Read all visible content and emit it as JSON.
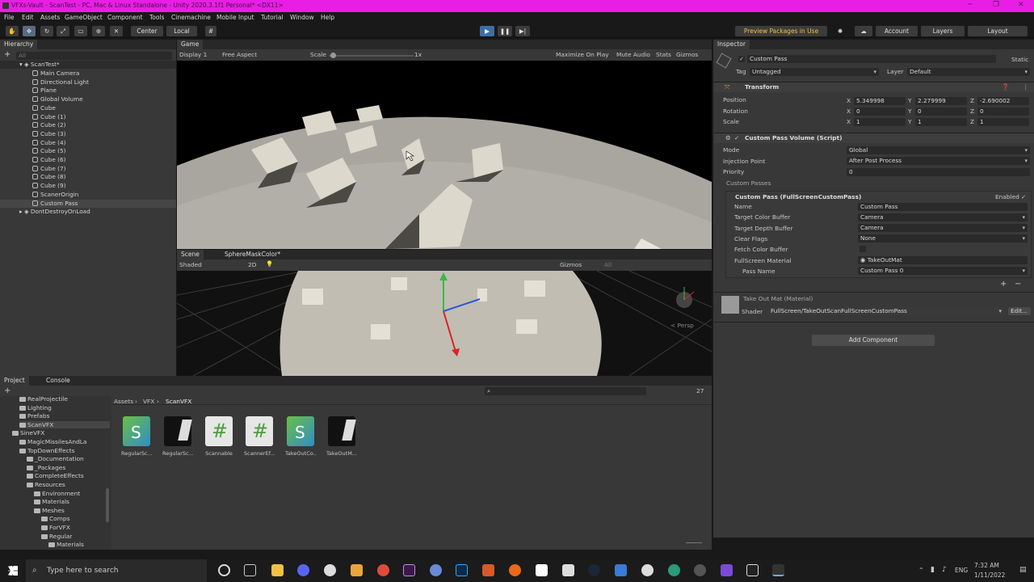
{
  "window": {
    "title": "VFXs-Vault - ScanTest - PC, Mac & Linux Standalone - Unity 2020.3.1f1 Personal* <DX11>"
  },
  "menu": [
    "File",
    "Edit",
    "Assets",
    "GameObject",
    "Component",
    "Tools",
    "Cinemachine",
    "Mobile Input",
    "Tutorial",
    "Window",
    "Help"
  ],
  "toolbar": {
    "center": "Center",
    "local": "Local",
    "preview": "Preview Packages in Use",
    "account": "Account",
    "layers": "Layers",
    "layout": "Layout"
  },
  "hierarchy": {
    "tab": "Hierarchy",
    "search_placeholder": "All",
    "scene": "ScanTest*",
    "items": [
      "Main Camera",
      "Directional Light",
      "Plane",
      "Global Volume",
      "Cube",
      "Cube (1)",
      "Cube (2)",
      "Cube (3)",
      "Cube (4)",
      "Cube (5)",
      "Cube (6)",
      "Cube (7)",
      "Cube (8)",
      "Cube (9)",
      "ScanerOrigin",
      "Custom Pass"
    ],
    "dontdestroy": "DontDestroyOnLoad"
  },
  "game": {
    "tab": "Game",
    "display": "Display 1",
    "aspect": "Free Aspect",
    "scale_label": "Scale",
    "scale_value": "1x",
    "maximize": "Maximize On Play",
    "mute": "Mute Audio",
    "stats": "Stats",
    "gizmos": "Gizmos"
  },
  "scene": {
    "tab": "Scene",
    "tab2": "SphereMaskColor*",
    "shading": "Shaded",
    "twod": "2D",
    "gizmos": "Gizmos",
    "search": "All",
    "persp": "< Persp"
  },
  "inspector": {
    "tab": "Inspector",
    "object_name": "Custom Pass",
    "static": "Static",
    "tag_label": "Tag",
    "tag": "Untagged",
    "layer_label": "Layer",
    "layer": "Default",
    "transform": {
      "title": "Transform",
      "position_label": "Position",
      "rotation_label": "Rotation",
      "scale_label": "Scale",
      "position": {
        "x": "5.349998",
        "y": "2.279999",
        "z": "-2.690002"
      },
      "rotation": {
        "x": "0",
        "y": "0",
        "z": "0"
      },
      "scale": {
        "x": "1",
        "y": "1",
        "z": "1"
      }
    },
    "cpv": {
      "title": "Custom Pass Volume (Script)",
      "mode_label": "Mode",
      "mode": "Global",
      "injection_label": "Injection Point",
      "injection": "After Post Process",
      "priority_label": "Priority",
      "priority": "0",
      "passes_label": "Custom Passes"
    },
    "pass": {
      "title": "Custom Pass (FullScreenCustomPass)",
      "enabled": "Enabled",
      "name_label": "Name",
      "name": "Custom Pass",
      "tcb_label": "Target Color Buffer",
      "tcb": "Camera",
      "tdb_label": "Target Depth Buffer",
      "tdb": "Camera",
      "clear_label": "Clear Flags",
      "clear": "None",
      "fetch_label": "Fetch Color Buffer",
      "fsm_label": "FullScreen Material",
      "fsm": "TakeOutMat",
      "passname_label": "Pass Name",
      "passname": "Custom Pass 0"
    },
    "material": {
      "title": "Take Out Mat (Material)",
      "shader_label": "Shader",
      "shader": "FullScreen/TakeOutScanFullScreenCustomPass",
      "edit": "Edit..."
    },
    "add_component": "Add Component"
  },
  "project": {
    "tab": "Project",
    "tab2": "Console",
    "count": "27",
    "breadcrumb": [
      "Assets",
      "VFX",
      "ScanVFX"
    ],
    "tree": [
      {
        "t": "RealProjectile",
        "d": 2
      },
      {
        "t": "Lighting",
        "d": 2
      },
      {
        "t": "Prefabs",
        "d": 2
      },
      {
        "t": "ScanVFX",
        "d": 2
      },
      {
        "t": "SineVFX",
        "d": 1
      },
      {
        "t": "MagicMissilesAndLa",
        "d": 2
      },
      {
        "t": "TopDownEffects",
        "d": 2
      },
      {
        "t": "_Documentation",
        "d": 3
      },
      {
        "t": "_Packages",
        "d": 3
      },
      {
        "t": "CompleteEffects",
        "d": 3
      },
      {
        "t": "Resources",
        "d": 3
      },
      {
        "t": "Environment",
        "d": 4
      },
      {
        "t": "Materials",
        "d": 4
      },
      {
        "t": "Meshes",
        "d": 4
      },
      {
        "t": "Comps",
        "d": 5
      },
      {
        "t": "ForVFX",
        "d": 5
      },
      {
        "t": "Regular",
        "d": 5
      },
      {
        "t": "Materials",
        "d": 6
      }
    ],
    "assets": [
      "RegularSc...",
      "RegularSc...",
      "Scannable",
      "ScannerEf...",
      "TakeOutCo...",
      "TakeOutM..."
    ]
  },
  "taskbar": {
    "search": "Type here to search",
    "lang": "ENG",
    "time": "7:32 AM",
    "date": "1/11/2022"
  }
}
